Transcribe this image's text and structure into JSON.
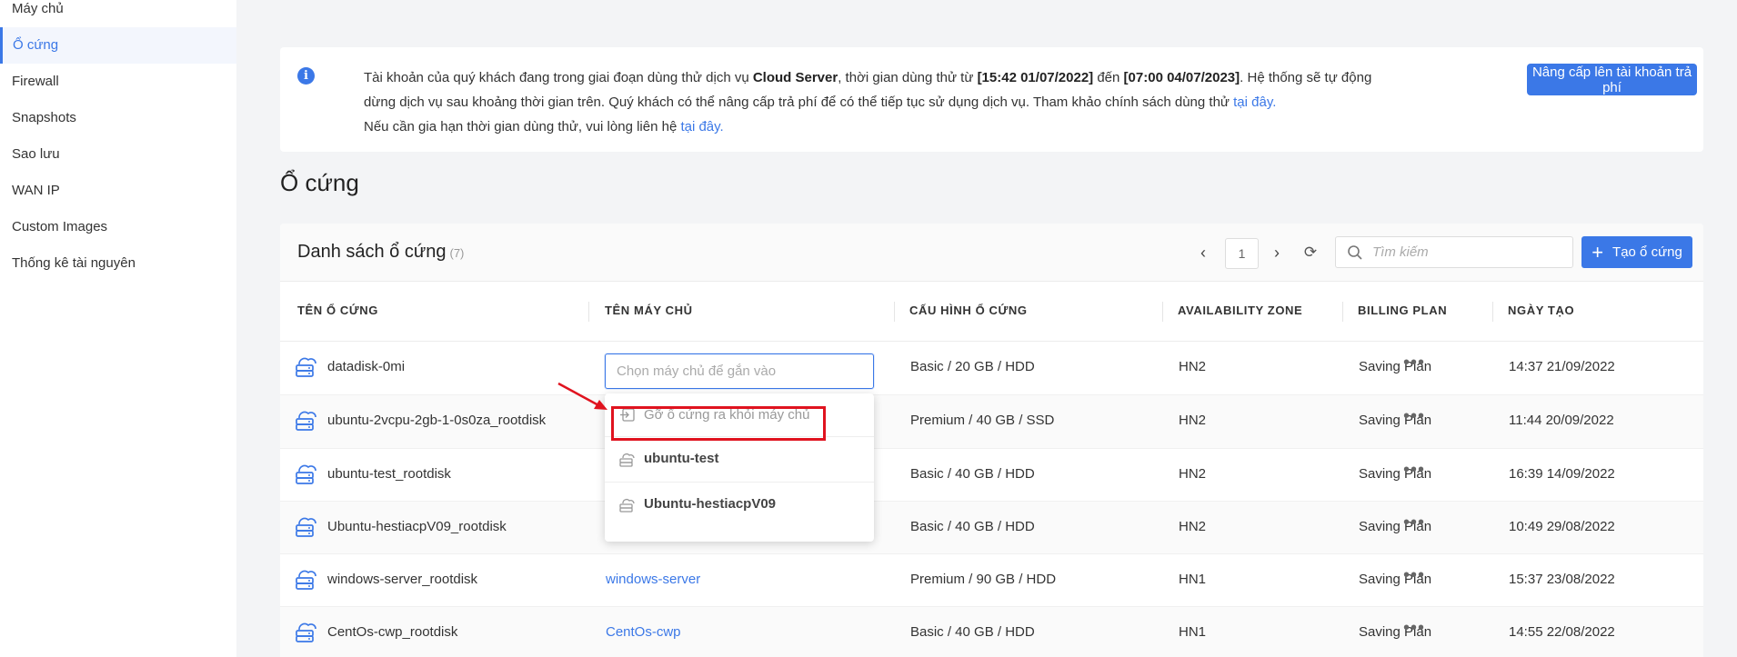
{
  "sidebar": {
    "items": [
      {
        "label": "Máy chủ",
        "active": false
      },
      {
        "label": "Ổ cứng",
        "active": true
      },
      {
        "label": "Firewall",
        "active": false
      },
      {
        "label": "Snapshots",
        "active": false
      },
      {
        "label": "Sao lưu",
        "active": false
      },
      {
        "label": "WAN IP",
        "active": false
      },
      {
        "label": "Custom Images",
        "active": false
      },
      {
        "label": "Thống kê tài nguyên",
        "active": false
      }
    ]
  },
  "notice": {
    "line1_a": "Tài khoản của quý khách đang trong giai đoạn dùng thử dịch vụ ",
    "line1_service": "Cloud Server",
    "line1_b": ", thời gian dùng thử từ ",
    "trial_start": "[15:42 01/07/2022]",
    "line1_c": " đến ",
    "trial_end": "[07:00 04/07/2023]",
    "line1_d": ". Hệ thống sẽ tự động",
    "line2": "dừng dịch vụ sau khoảng thời gian trên. Quý khách có thể nâng cấp trả phí để có thể tiếp tục sử dụng dịch vụ. Tham khảo chính sách dùng thử ",
    "line2_link": "tại đây.",
    "line3": "Nếu cần gia hạn thời gian dùng thử, vui lòng liên hệ ",
    "line3_link": "tại đây.",
    "upgrade_label": "Nâng cấp lên tài khoản trả phí"
  },
  "page_title": "Ổ cứng",
  "panel": {
    "title": "Danh sách ổ cứng",
    "count": "(7)",
    "page": "1",
    "search_placeholder": "Tìm kiếm",
    "create_label": "Tạo ổ cứng"
  },
  "table": {
    "headers": [
      "TÊN Ổ CỨNG",
      "TÊN MÁY CHỦ",
      "CẤU HÌNH Ổ CỨNG",
      "AVAILABILITY ZONE",
      "BILLING PLAN",
      "NGÀY TẠO"
    ],
    "rows": [
      {
        "name": "datadisk-0mi",
        "server": "",
        "config": "Basic / 20 GB / HDD",
        "zone": "HN2",
        "plan": "Saving Plan",
        "created": "14:37 21/09/2022"
      },
      {
        "name": "ubuntu-2vcpu-2gb-1-0s0za_rootdisk",
        "server": "",
        "config": "Premium / 40 GB / SSD",
        "zone": "HN2",
        "plan": "Saving Plan",
        "created": "11:44 20/09/2022"
      },
      {
        "name": "ubuntu-test_rootdisk",
        "server": "",
        "config": "Basic / 40 GB / HDD",
        "zone": "HN2",
        "plan": "Saving Plan",
        "created": "16:39 14/09/2022"
      },
      {
        "name": "Ubuntu-hestiacpV09_rootdisk",
        "server": "",
        "config": "Basic / 40 GB / HDD",
        "zone": "HN2",
        "plan": "Saving Plan",
        "created": "10:49 29/08/2022"
      },
      {
        "name": "windows-server_rootdisk",
        "server": "windows-server",
        "config": "Premium / 90 GB / HDD",
        "zone": "HN1",
        "plan": "Saving Plan",
        "created": "15:37 23/08/2022"
      },
      {
        "name": "CentOs-cwp_rootdisk",
        "server": "CentOs-cwp",
        "config": "Basic / 40 GB / HDD",
        "zone": "HN1",
        "plan": "Saving Plan",
        "created": "14:55 22/08/2022"
      }
    ]
  },
  "server_select": {
    "placeholder": "Chọn máy chủ để gắn vào",
    "options": [
      {
        "label": "Gỡ ổ cứng ra khỏi máy chủ",
        "type": "detach"
      },
      {
        "label": "ubuntu-test",
        "type": "server"
      },
      {
        "label": "Ubuntu-hestiacpV09",
        "type": "server"
      }
    ]
  },
  "colors": {
    "accent": "#3b78e7",
    "highlight": "#e0131f"
  },
  "icons": [
    "info-icon",
    "chevron-left-icon",
    "chevron-right-icon",
    "refresh-icon",
    "search-icon",
    "plus-icon",
    "disk-icon",
    "more-icon",
    "detach-icon",
    "server-icon"
  ]
}
